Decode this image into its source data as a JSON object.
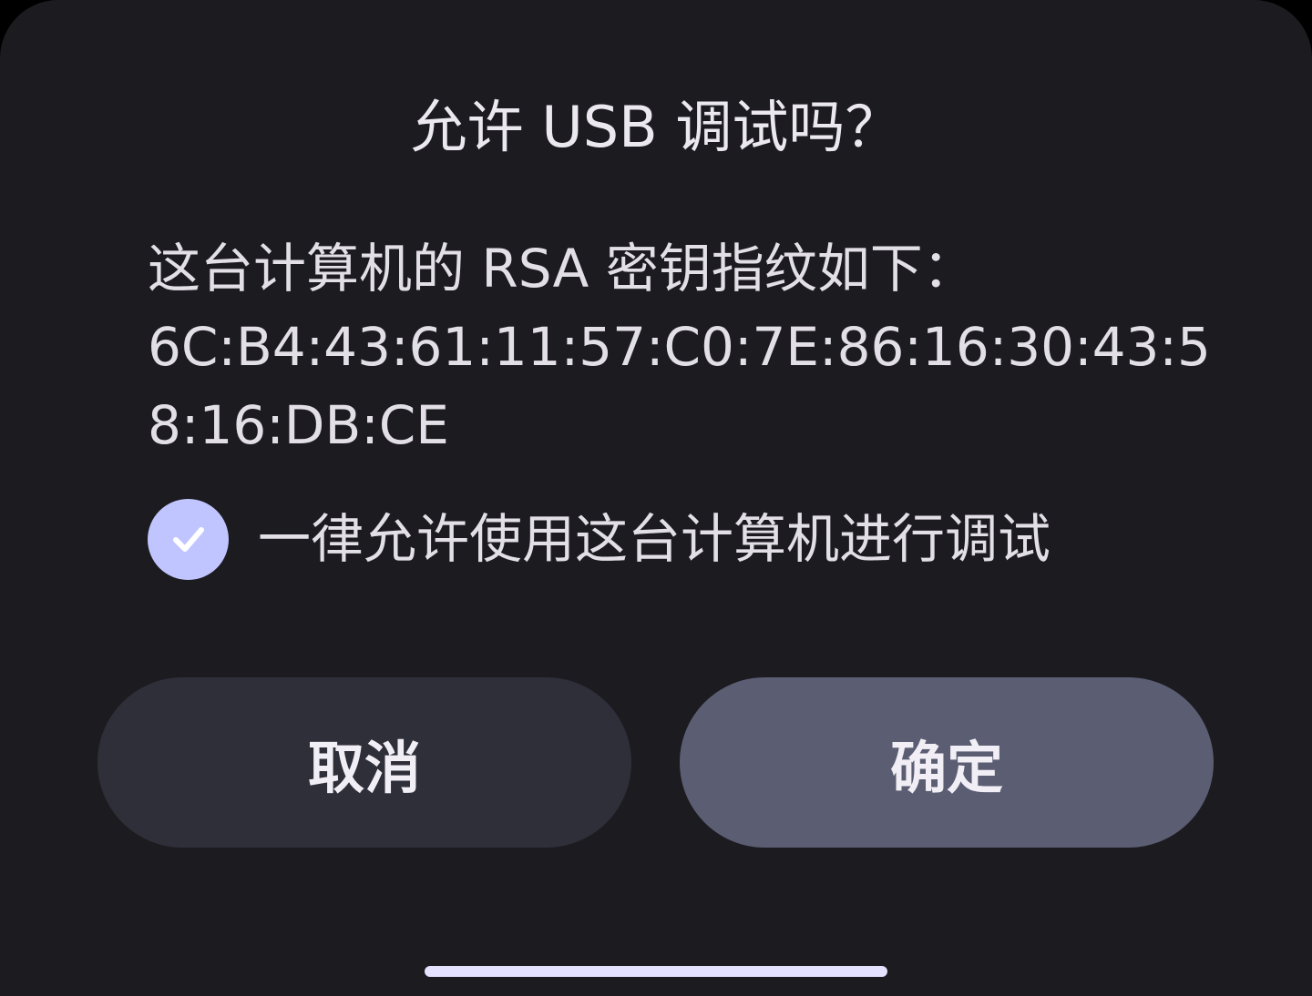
{
  "dialog": {
    "title": "允许 USB 调试吗？",
    "message_line1": "这台计算机的 RSA 密钥指纹如下：",
    "fingerprint_line1": "6C:B4:43:61:11:57:C0:7E:86:16:30:43:5",
    "fingerprint_line2": "8:16:DB:CE",
    "always_allow_label": "一律允许使用这台计算机进行调试",
    "always_allow_checked": true,
    "cancel_label": "取消",
    "ok_label": "确定",
    "icons": {
      "checkbox": "check-icon"
    }
  },
  "colors": {
    "background": "#1c1b20",
    "checkbox_accent": "#c0c5ff",
    "cancel_button": "#2f2f3a",
    "ok_button": "#5b5d73",
    "home_indicator": "#e4e2ff"
  }
}
